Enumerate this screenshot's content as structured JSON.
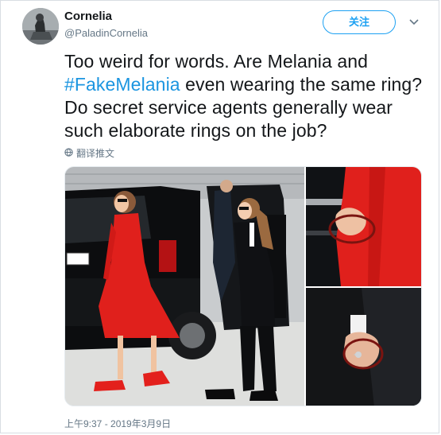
{
  "user": {
    "display_name": "Cornelia",
    "handle": "@PaladinCornelia"
  },
  "actions": {
    "follow_label": "关注"
  },
  "tweet": {
    "text_before": "Too weird for words.  Are Melania and ",
    "hashtag": "#FakeMelania",
    "text_after": " even wearing the same ring?  Do secret service agents generally wear such elaborate rings on the job?",
    "translate_label": "翻译推文",
    "timestamp": "上午9:37 - 2019年3月9日"
  },
  "colors": {
    "accent": "#1da1f2",
    "hashtag": "#1b95e0",
    "circle_highlight": "#7a1410",
    "dress_red": "#e0201c"
  },
  "icons": {
    "dropdown": "chevron-down-icon",
    "translate": "globe-icon"
  }
}
